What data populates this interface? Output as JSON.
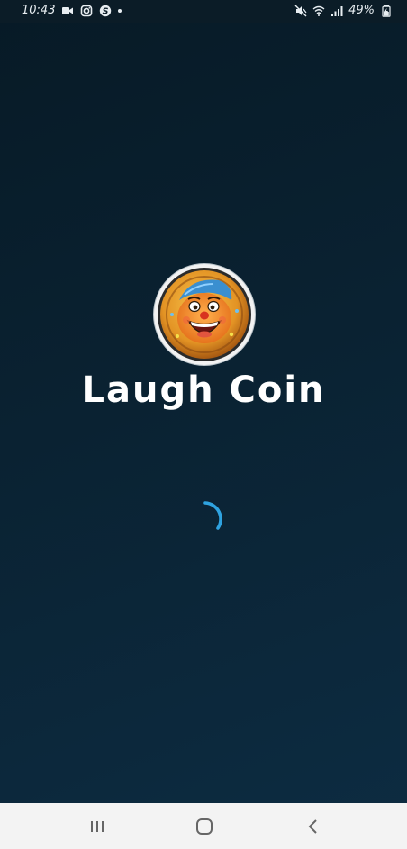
{
  "status_bar": {
    "time": "10:43",
    "battery": "49%",
    "left_icons": [
      "video-call-icon",
      "instagram-icon",
      "skype-icon",
      "notification-dot-icon"
    ],
    "right_icons": [
      "mute-icon",
      "wifi-icon",
      "signal-icon",
      "battery-icon"
    ]
  },
  "splash": {
    "app_name": "Laugh Coin",
    "logo_icon": "laughing-clown-coin-icon",
    "loading_icon": "loading-spinner-icon"
  },
  "nav_bar": {
    "buttons": [
      "recents-icon",
      "home-icon",
      "back-icon"
    ]
  },
  "colors": {
    "background_top": "#071a26",
    "background_bottom": "#0d2c42",
    "spinner": "#2fa3e0",
    "title": "#ffffff",
    "nav_bar": "#f3f3f3"
  }
}
